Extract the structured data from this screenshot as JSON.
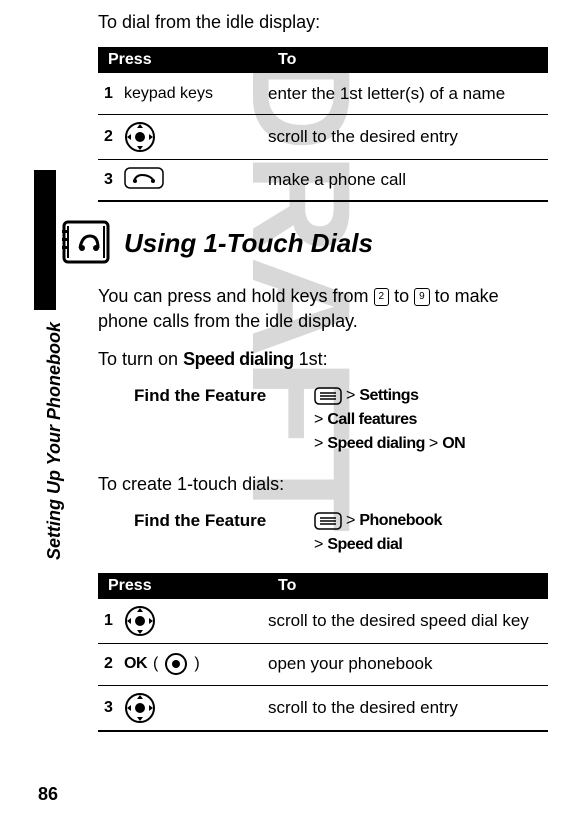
{
  "watermark": "DRAFT",
  "side_label": "Setting Up Your Phonebook",
  "page_number": "86",
  "intro_text": "To dial from the idle display:",
  "table1": {
    "headers": {
      "press": "Press",
      "to": "To"
    },
    "rows": [
      {
        "num": "1",
        "press": "keypad keys",
        "to": "enter the 1st letter(s) of a name",
        "icon": "none"
      },
      {
        "num": "2",
        "press": "",
        "to": "scroll to the desired entry",
        "icon": "nav"
      },
      {
        "num": "3",
        "press": "",
        "to": "make a phone call",
        "icon": "call"
      }
    ]
  },
  "section_heading": "Using 1-Touch Dials",
  "para1_pre": "You can press and hold keys from ",
  "para1_key1": "2",
  "para1_mid": " to ",
  "para1_key2": "9",
  "para1_post": " to make phone calls from the idle display.",
  "turn_on_pre": "To turn on ",
  "turn_on_bold": "Speed dialing",
  "turn_on_post": " 1st:",
  "find_feature_label": "Find the Feature",
  "path1": {
    "line1_gt": ">",
    "line1": "Settings",
    "line2_gt": ">",
    "line2": "Call features",
    "line3_gt1": ">",
    "line3_a": "Speed dialing",
    "line3_gt2": ">",
    "line3_b": "ON"
  },
  "create_text": "To create 1-touch dials:",
  "path2": {
    "line1_gt": ">",
    "line1": "Phonebook",
    "line2_gt": ">",
    "line2": "Speed dial"
  },
  "table2": {
    "headers": {
      "press": "Press",
      "to": "To"
    },
    "rows": [
      {
        "num": "1",
        "press": "",
        "to": "scroll to the desired speed dial key",
        "icon": "nav"
      },
      {
        "num": "2",
        "press_pre": "OK",
        "press_post": "(",
        "press_close": ")",
        "to": "open your phonebook",
        "icon": "center"
      },
      {
        "num": "3",
        "press": "",
        "to": "scroll to the desired entry",
        "icon": "nav"
      }
    ]
  }
}
